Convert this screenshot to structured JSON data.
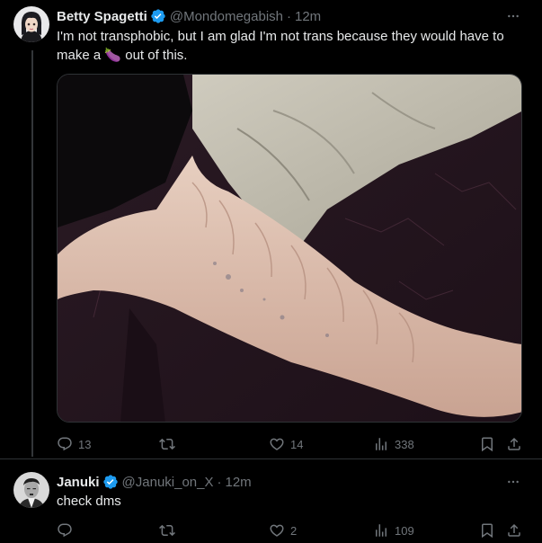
{
  "tweet": {
    "author_name": "Betty Spagetti",
    "author_handle": "@Mondomegabish",
    "separator": "·",
    "time": "12m",
    "text_line1": "I'm not transphobic, but I am glad I'm not trans because they would have to",
    "text_line2_before": "make a",
    "text_line2_emoji": "🍆",
    "text_line2_after": "out of this.",
    "stats": {
      "replies": "13",
      "reposts": "",
      "likes": "14",
      "views": "338"
    }
  },
  "reply": {
    "author_name": "Januki",
    "author_handle": "@Januki_on_X",
    "separator": "·",
    "time": "12m",
    "text": "check dms",
    "stats": {
      "replies": "",
      "reposts": "",
      "likes": "2",
      "views": "109"
    }
  },
  "colors": {
    "background": "#000000",
    "text": "#e7e9ea",
    "muted": "#71767b",
    "verified": "#1d9bf0",
    "border": "#2f3336"
  },
  "icons": [
    "verified-badge-icon",
    "more-icon",
    "reply-icon",
    "repost-icon",
    "like-icon",
    "views-icon",
    "bookmark-icon",
    "share-icon"
  ]
}
